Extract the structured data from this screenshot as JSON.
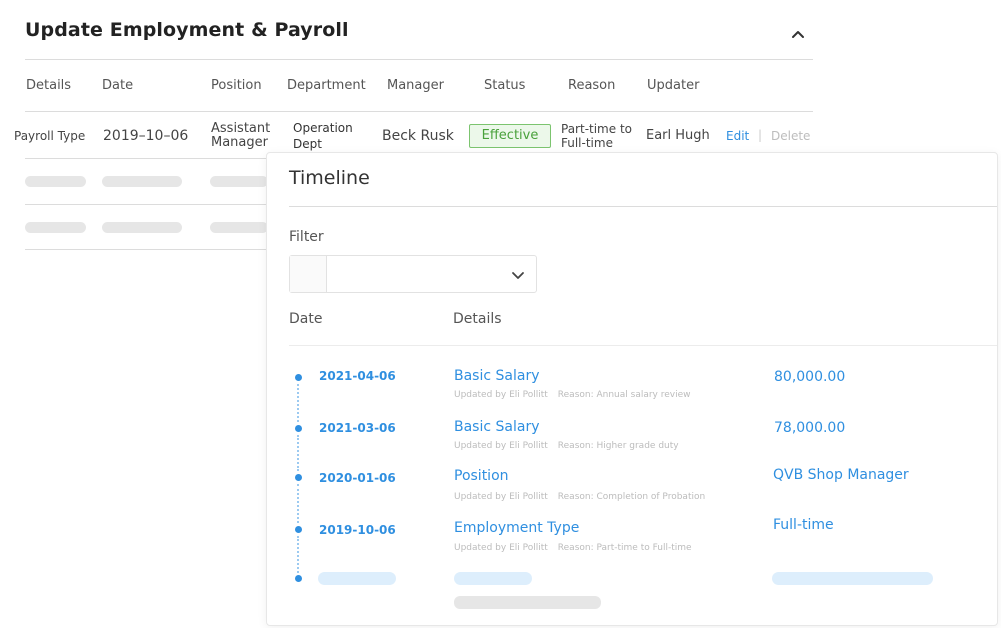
{
  "header": {
    "title": "Update Employment & Payroll"
  },
  "table": {
    "columns": [
      "Details",
      "Date",
      "Position",
      "Department",
      "Manager",
      "Status",
      "Reason",
      "Updater"
    ],
    "row": {
      "details": "Payroll Type",
      "date": "2019–10–06",
      "position_line1": "Assistant",
      "position_line2": "Manager",
      "department_line1": "Operation",
      "department_line2": "Dept",
      "manager": "Beck Rusk",
      "status": "Effective",
      "reason_line1": "Part-time to",
      "reason_line2": "Full-time",
      "updater": "Earl Hugh",
      "edit": "Edit",
      "separator": "|",
      "delete": "Delete"
    }
  },
  "timeline": {
    "title": "Timeline",
    "filter_label": "Filter",
    "filter_value": "",
    "col_date": "Date",
    "col_details": "Details",
    "entries": [
      {
        "date": "2021-04-06",
        "name": "Basic Salary",
        "updated_by": "Updated by Eli Pollitt",
        "reason": "Reason: Annual salary review",
        "value": "80,000.00"
      },
      {
        "date": "2021-03-06",
        "name": "Basic Salary",
        "updated_by": "Updated by Eli Pollitt",
        "reason": "Reason: Higher grade duty",
        "value": "78,000.00"
      },
      {
        "date": "2020-01-06",
        "name": "Position",
        "updated_by": "Updated by Eli Pollitt",
        "reason": "Reason: Completion of Probation",
        "value": "QVB Shop Manager"
      },
      {
        "date": "2019-10-06",
        "name": "Employment Type",
        "updated_by": "Updated by Eli Pollitt",
        "reason": "Reason: Part-time to Full-time",
        "value": "Full-time"
      }
    ]
  },
  "colors": {
    "accent": "#2f8fe0",
    "status_green": "#49a13b"
  },
  "icons": {
    "collapse": "chevron-up-icon",
    "dropdown": "chevron-down-icon"
  }
}
